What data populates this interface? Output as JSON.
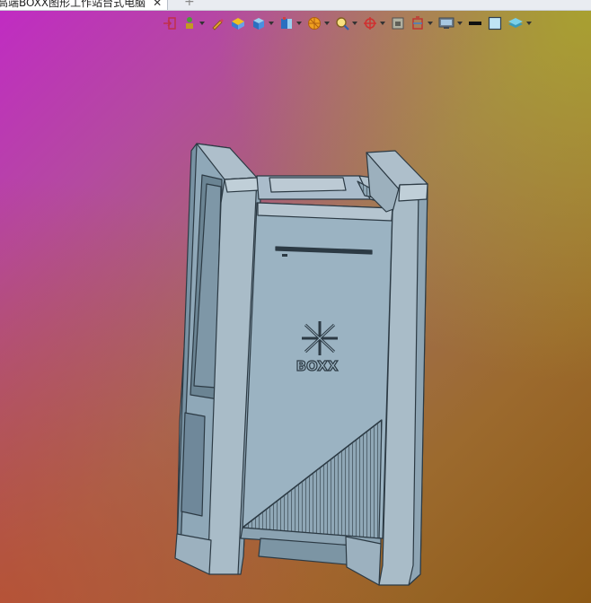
{
  "document": {
    "tab_title": "高端BOXX图形工作站台式电脑",
    "close_glyph": "✕",
    "new_tab_glyph": "+"
  },
  "toolbar": {
    "items": [
      {
        "icon": "exit-sketch-icon",
        "has_dropdown": false
      },
      {
        "icon": "move-icon",
        "has_dropdown": true
      },
      {
        "icon": "pencil-icon",
        "has_dropdown": false
      },
      {
        "icon": "section-view-icon",
        "has_dropdown": false
      },
      {
        "icon": "view-orientation-icon",
        "has_dropdown": true
      },
      {
        "icon": "display-style-icon",
        "has_dropdown": true
      },
      {
        "icon": "hide-show-icon",
        "has_dropdown": true
      },
      {
        "icon": "zoom-icon",
        "has_dropdown": true
      },
      {
        "icon": "rotate-icon",
        "has_dropdown": true
      },
      {
        "icon": "scene-icon",
        "has_dropdown": false
      },
      {
        "icon": "appearance-icon",
        "has_dropdown": true
      },
      {
        "icon": "monitor-icon",
        "has_dropdown": true
      },
      {
        "icon": "line-color-icon",
        "has_dropdown": false
      },
      {
        "icon": "background-color-icon",
        "has_dropdown": false
      },
      {
        "icon": "layers-icon",
        "has_dropdown": true
      }
    ]
  },
  "viewport": {
    "background_colors": [
      "#c12ac4",
      "#a2705c",
      "#8e5a16"
    ],
    "model_color": "#9bb3c2",
    "model_dark": "#3a4c58",
    "logo_text": "BOXX"
  }
}
